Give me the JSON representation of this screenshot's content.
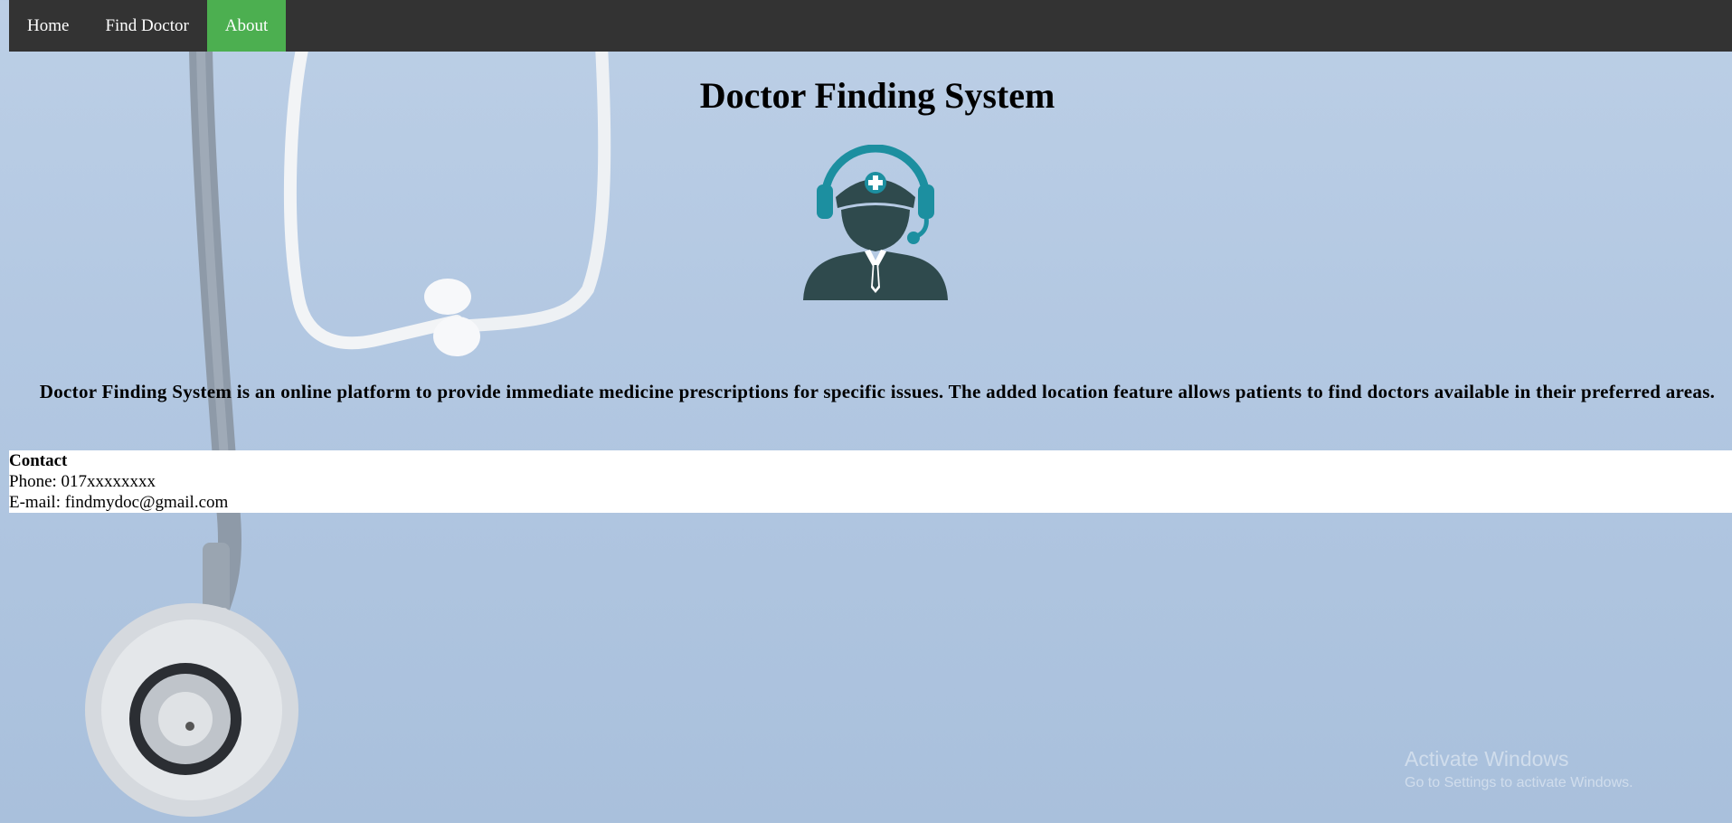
{
  "nav": {
    "items": [
      {
        "label": "Home",
        "active": false
      },
      {
        "label": "Find Doctor",
        "active": false
      },
      {
        "label": "About",
        "active": true
      }
    ],
    "active_color": "#4caf50",
    "bar_color": "#333333"
  },
  "page_title": "Doctor Finding System",
  "logo_icon": "doctor-headset-icon",
  "description": "Doctor Finding System is an online platform to provide immediate medicine prescriptions for specific issues. The added location feature allows patients to find doctors available in their preferred areas.",
  "contact": {
    "title": "Contact",
    "phone": "Phone: 017xxxxxxxx",
    "email": "E-mail: findmydoc@gmail.com"
  },
  "watermark": {
    "title": "Activate Windows",
    "subtitle": "Go to Settings to activate Windows."
  }
}
